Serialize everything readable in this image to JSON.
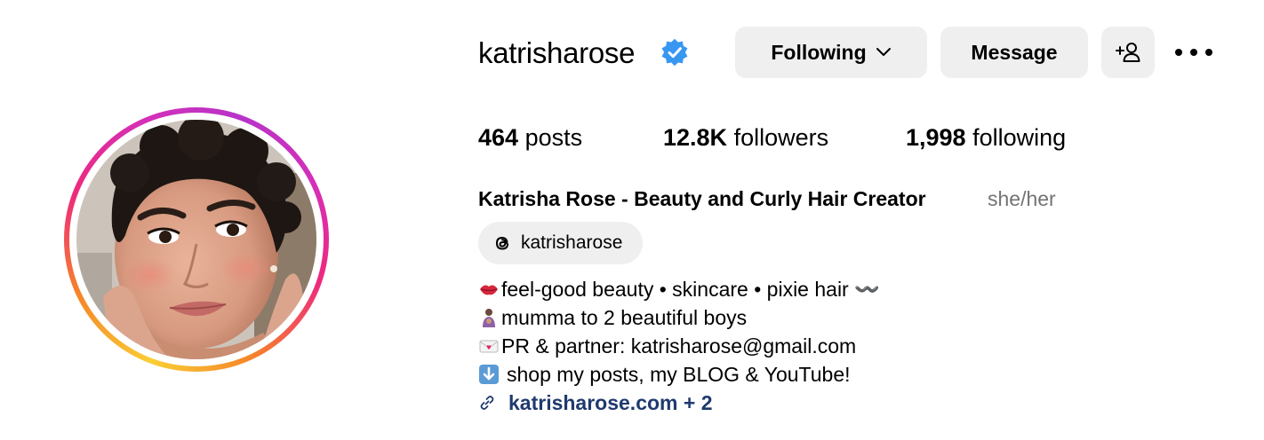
{
  "profile": {
    "username": "katrisharose",
    "buttons": {
      "following": "Following",
      "message": "Message"
    },
    "stats": {
      "posts_count": "464",
      "posts_label": "posts",
      "followers_count": "12.8K",
      "followers_label": "followers",
      "following_count": "1,998",
      "following_label": "following"
    },
    "full_name": "Katrisha Rose - Beauty and Curly Hair Creator",
    "pronouns": "she/her",
    "threads_handle": "katrisharose",
    "bio": [
      "feel-good beauty • skincare • pixie hair 〰️",
      "mumma to 2 beautiful boys",
      "PR & partner: katrisharose@gmail.com",
      "shop my posts, my BLOG & YouTube!"
    ],
    "link_text": "katrisharose.com + 2"
  },
  "colors": {
    "verified": "#3897f0",
    "link": "#1f3a6e",
    "button_bg": "#efefef",
    "muted": "#737373"
  },
  "icons": [
    "verified-badge-icon",
    "chevron-down-icon",
    "add-person-icon",
    "more-options-icon",
    "threads-icon",
    "lips-icon",
    "mother-baby-icon",
    "love-letter-icon",
    "down-arrow-icon",
    "link-icon"
  ]
}
